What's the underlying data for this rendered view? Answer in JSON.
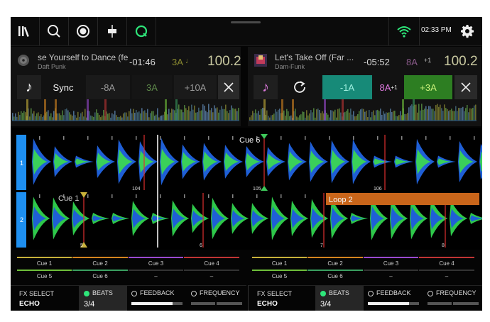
{
  "topbar": {
    "icons": [
      "library-icon",
      "search-icon",
      "record-icon",
      "crossfader-icon",
      "quantize-icon"
    ],
    "clock": "02:33 PM"
  },
  "deck1": {
    "title": "se Yourself to Dance (fe",
    "artist": "Daft Punk",
    "time": "-01:46",
    "key": "3A",
    "bpm": "100.2",
    "sync_label": "Sync",
    "keys": [
      "-8A",
      "3A",
      "+10A"
    ]
  },
  "deck2": {
    "title": "Let's Take Off (Far ...",
    "artist": "Dam-Funk",
    "time": "-05:52",
    "key": "8A",
    "key_adjust": "+1",
    "bpm": "100.2",
    "keys": [
      "-1A",
      "8A",
      "+3A"
    ],
    "key_small": "+1"
  },
  "waveform": {
    "deck_labels": [
      "1",
      "2"
    ],
    "cue6_label": "Cue 6",
    "cue1_label": "Cue 1",
    "loop_label": "Loop 2",
    "beat_markers": [
      "104",
      "105",
      "106"
    ],
    "bottom_markers": [
      "5",
      "6",
      "7",
      "8"
    ]
  },
  "cues": {
    "deck1": [
      "Cue 1",
      "Cue 2",
      "Cue 3",
      "Cue 4",
      "Cue 5",
      "Cue 6",
      "–",
      "–"
    ],
    "deck2": [
      "Cue 1",
      "Cue 2",
      "Cue 3",
      "Cue 4",
      "Cue 5",
      "Cue 6",
      "–",
      "–"
    ],
    "colors": [
      "#c9b23a",
      "#d6851f",
      "#9b4ad1",
      "#c23535",
      "#6fbf3a",
      "#3a9f60",
      "#333333",
      "#333333"
    ]
  },
  "fx": {
    "deck1": {
      "label": "FX SELECT",
      "effect": "ECHO",
      "beats_label": "BEATS",
      "beats_value": "3/4",
      "feedback_label": "FEEDBACK",
      "frequency_label": "FREQUENCY"
    },
    "deck2": {
      "label": "FX SELECT",
      "effect": "ECHO",
      "beats_label": "BEATS",
      "beats_value": "3/4",
      "feedback_label": "FEEDBACK",
      "frequency_label": "FREQUENCY"
    }
  },
  "colors": {
    "accent": "#2ee67a",
    "deck1": "#1e8ff0",
    "loop": "#c8651a",
    "key_active": "#1a8c78",
    "key_plus": "#2f8a26"
  }
}
